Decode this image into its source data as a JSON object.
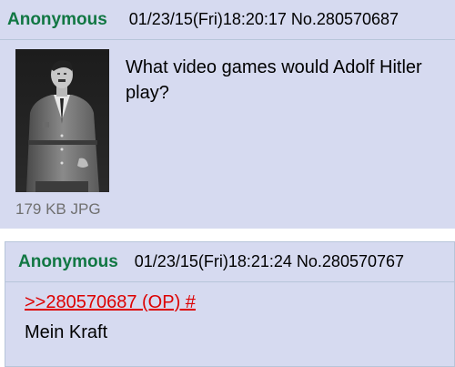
{
  "op_post": {
    "name": "Anonymous",
    "datetime": "01/23/15(Fri)18:20:17",
    "post_no": "No.280570687",
    "file_info": "179 KB JPG",
    "comment": "What video games would Adolf Hitler play?"
  },
  "reply_post": {
    "name": "Anonymous",
    "datetime": "01/23/15(Fri)18:21:24",
    "post_no": "No.280570767",
    "quote_link": ">>280570687 (OP) #",
    "comment": "Mein Kraft"
  },
  "colors": {
    "post_background": "#d6daf0",
    "name": "#117743",
    "quote_link": "#dd0000",
    "file_info": "#707070",
    "border": "#b7c5d9"
  }
}
